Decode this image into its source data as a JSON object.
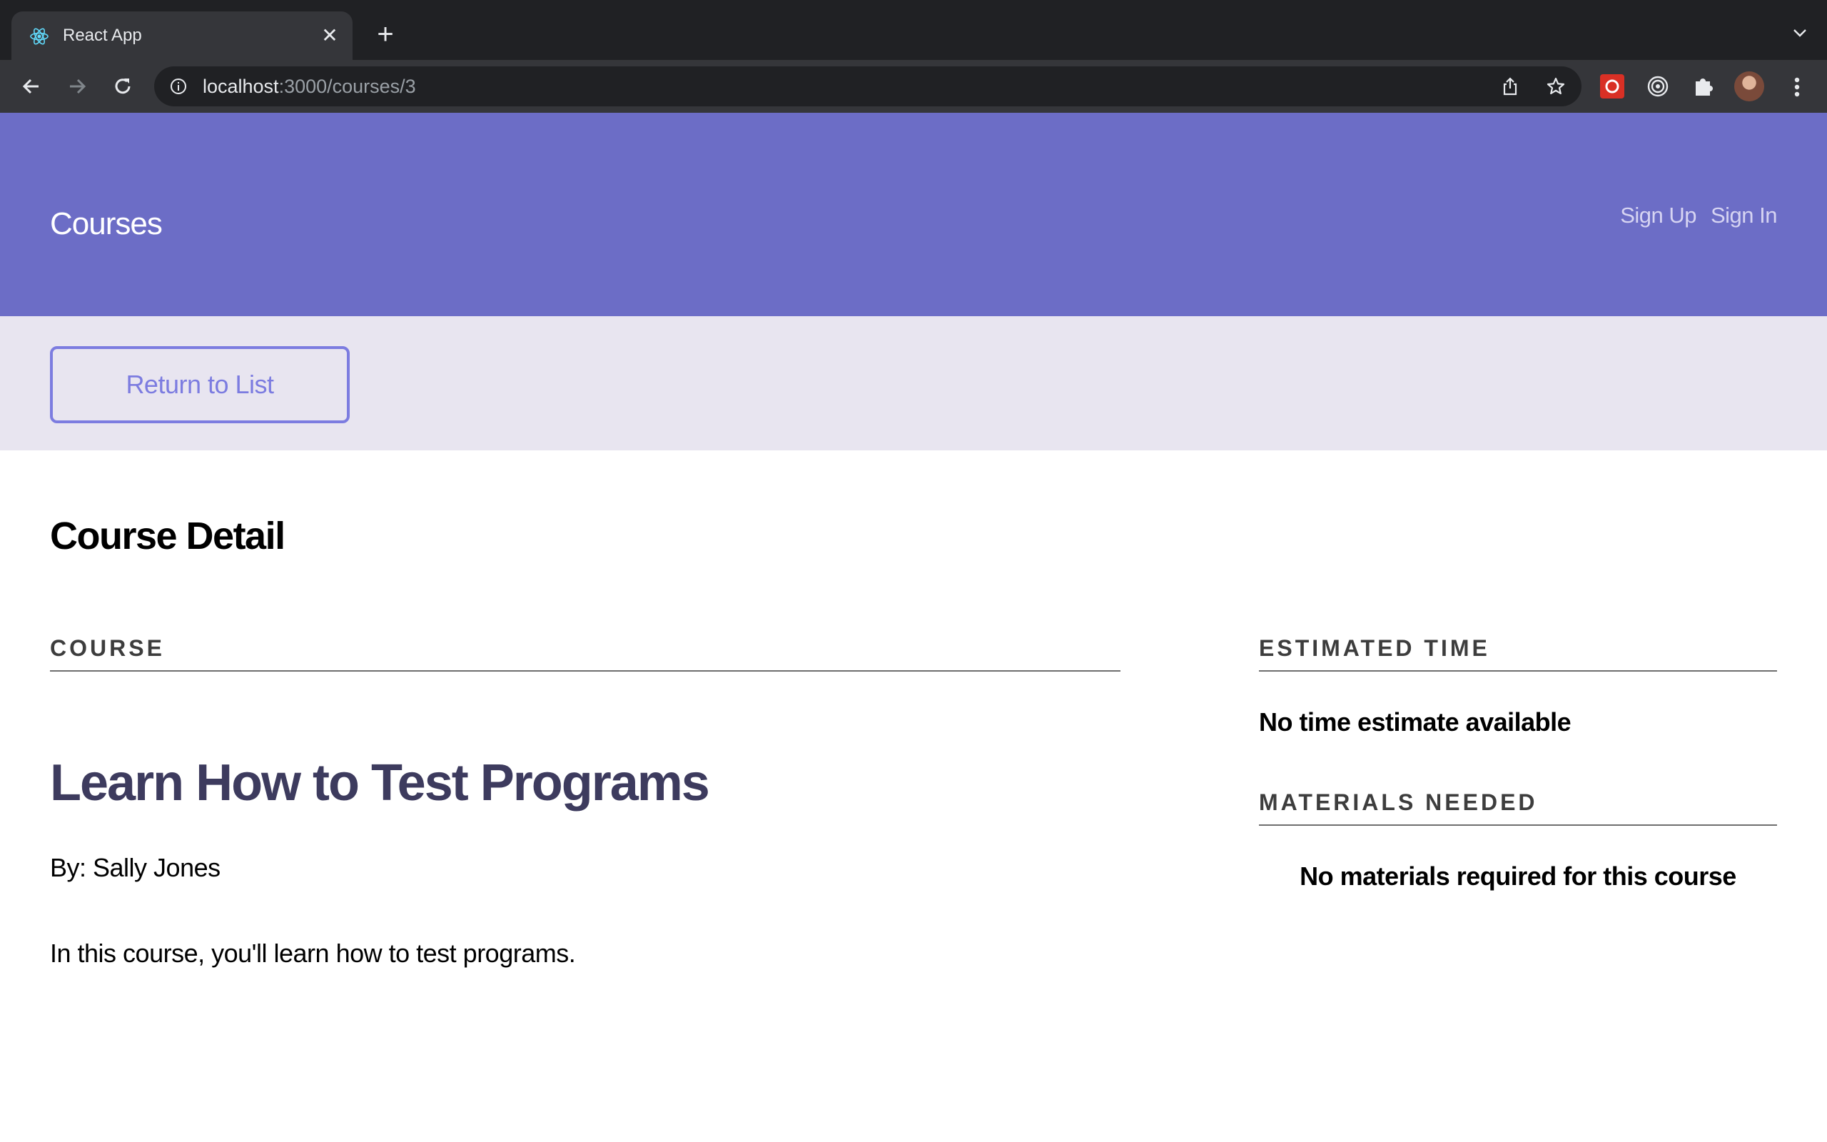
{
  "browser": {
    "tab_title": "React App",
    "tab_favicon": "react-icon",
    "url_host": "localhost",
    "url_path": ":3000/courses/3",
    "icons": [
      "back-arrow-icon",
      "forward-arrow-icon",
      "reload-icon",
      "info-icon",
      "share-icon",
      "star-icon",
      "extension-icon",
      "target-icon",
      "puzzle-icon",
      "profile-avatar",
      "more-vert-icon"
    ]
  },
  "header": {
    "logo": "Courses",
    "sign_up": "Sign Up",
    "sign_in": "Sign In",
    "bg_color": "#6c6dc6"
  },
  "actions": {
    "return_label": "Return to List",
    "accent_color": "#7c7ce0"
  },
  "main": {
    "page_title": "Course Detail",
    "course": {
      "section_label": "COURSE",
      "title": "Learn How to Test Programs",
      "author": "By: Sally Jones",
      "description": "In this course, you'll learn how to test programs."
    },
    "sidebar": {
      "time_label": "ESTIMATED TIME",
      "time_value": "No time estimate available",
      "materials_label": "MATERIALS NEEDED",
      "materials_value": "No materials required for this course"
    }
  }
}
